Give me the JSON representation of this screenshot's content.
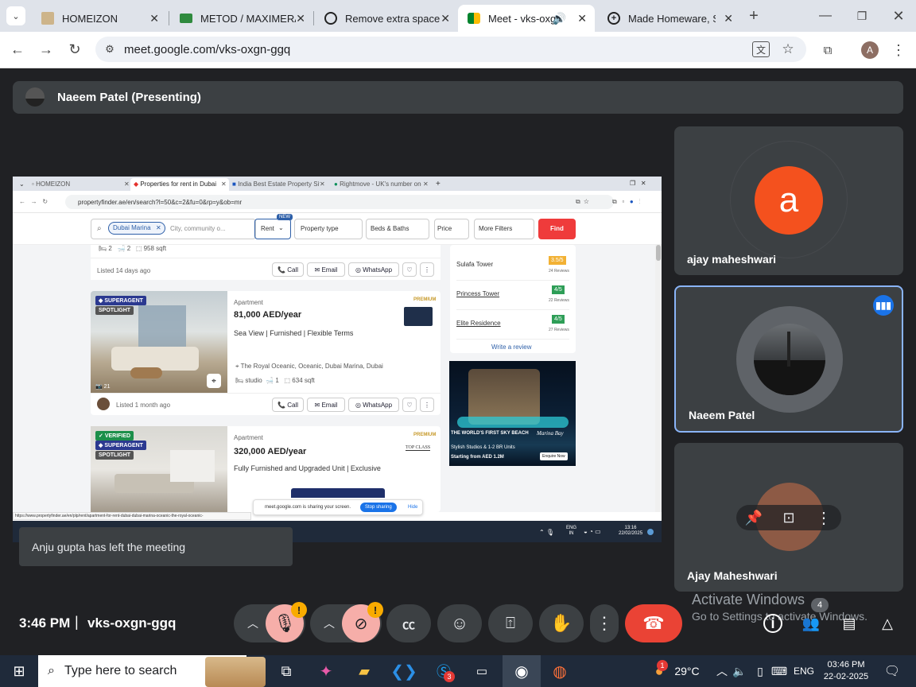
{
  "browser": {
    "tabs": [
      {
        "label": "HOMEIZON"
      },
      {
        "label": "METOD / MAXIMERA"
      },
      {
        "label": "Remove extra space"
      },
      {
        "label": "Meet - vks-oxgn-ggq"
      },
      {
        "label": "Made Homeware, Sofa"
      }
    ],
    "url": "meet.google.com/vks-oxgn-ggq",
    "profile_initial": "A"
  },
  "meet": {
    "presenter_bar": "Naeem Patel (Presenting)",
    "participants": [
      {
        "name": "ajay maheshwari",
        "initial": "a"
      },
      {
        "name": "Naeem Patel"
      },
      {
        "name": "Ajay Maheshwari"
      }
    ],
    "toast": "Anju gupta has left the meeting",
    "time": "3:46 PM",
    "separator": "|",
    "meeting_code": "vks-oxgn-ggq",
    "people_count": "4",
    "warn_mark": "!",
    "watermark_title": "Activate Windows",
    "watermark_sub": "Go to Settings to activate Windows."
  },
  "shared": {
    "tabs": [
      "HOMEIZON",
      "Properties for rent in Dubai Ma",
      "India Best Estate Property Site",
      "Rightmove - UK's number one"
    ],
    "url": "propertyfinder.ae/en/search?l=50&c=2&fu=0&rp=y&ob=mr",
    "search_chip": "Dubai Marina",
    "search_placeholder": "City, community o...",
    "rent": "Rent",
    "new_badge": "NEW",
    "filters": [
      "Property type",
      "Beds & Baths",
      "Price",
      "More Filters"
    ],
    "find": "Find",
    "top_row": {
      "beds": "2",
      "baths": "2",
      "area": "958 sqft",
      "listed": "Listed 14 days ago"
    },
    "actions": [
      "Call",
      "Email",
      "WhatsApp"
    ],
    "listing1": {
      "badges": [
        "SUPERAGENT",
        "SPOTLIGHT"
      ],
      "type": "Apartment",
      "price": "81,000 AED/year",
      "title": "Sea View | Furnished | Flexible Terms",
      "location": "The Royal Oceanic, Oceanic, Dubai Marina, Dubai",
      "beds": "studio",
      "baths": "1",
      "area": "634 sqft",
      "photos": "21",
      "listed": "Listed 1 month ago",
      "premium": "PREMIUM"
    },
    "listing2": {
      "badges": [
        "VERIFIED",
        "SUPERAGENT",
        "SPOTLIGHT"
      ],
      "type": "Apartment",
      "price": "320,000 AED/year",
      "title": "Fully Furnished and Upgraded Unit | Exclusive",
      "premium": "PREMIUM",
      "agency": "TOP CLASS"
    },
    "towers": [
      {
        "name": "Sulafa Tower",
        "score": "3.5/5",
        "reviews": "24 Reviews",
        "color": "#f2b134"
      },
      {
        "name": "Princess Tower",
        "score": "4/5",
        "reviews": "22 Reviews",
        "color": "#2e9e57"
      },
      {
        "name": "Elite Residence",
        "score": "4/5",
        "reviews": "27 Reviews",
        "color": "#2e9e57"
      }
    ],
    "write_review": "Write a review",
    "ad": {
      "headline": "THE WORLD'S FIRST SKY BEACH",
      "sub": "Stylish Studios & 1-2 BR Units",
      "price": "Starting from AED 1.2M",
      "cta": "Enquire Now",
      "brand": "Marina Bay"
    },
    "share_notice": "meet.google.com is sharing your screen.",
    "stop_sharing": "Stop sharing",
    "hide": "Hide",
    "status_url": "https://www.propertyfinder.ae/en/plp/rent/apartment-for-rent-dubai-dubai-marina-oceanic-the-royal-oceanic-",
    "tray_lang": "ENG",
    "tray_region": "IN",
    "tray_time": "13:16",
    "tray_date": "22/02/2025"
  },
  "taskbar": {
    "search": "Type here to search",
    "temp": "29°C",
    "lang": "ENG",
    "time": "03:46 PM",
    "date": "22-02-2025",
    "skype_badge": "3",
    "weather_badge": "1"
  },
  "colors": {
    "end_call": "#ea4335",
    "avatar": "#f4511e",
    "find": "#ef3b3b",
    "speaking": "#8ab4f8"
  }
}
